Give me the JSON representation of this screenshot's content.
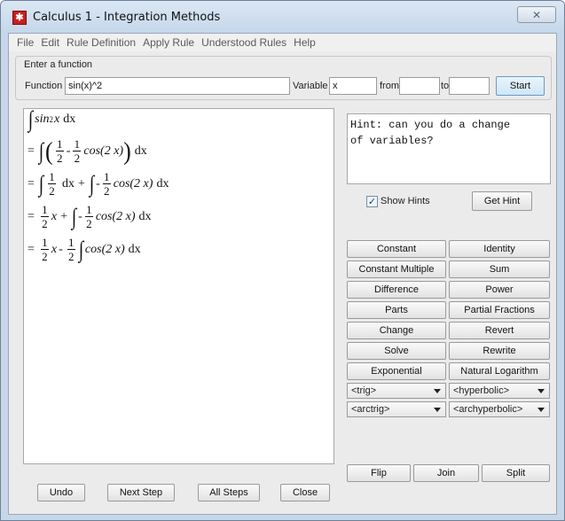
{
  "window": {
    "title": "Calculus 1 - Integration Methods",
    "close_glyph": "✕"
  },
  "menu": [
    "File",
    "Edit",
    "Rule Definition",
    "Apply Rule",
    "Understood Rules",
    "Help"
  ],
  "function_panel": {
    "legend": "Enter a function",
    "function_label": "Function",
    "function_value": "sin(x)^2",
    "variable_label": "Variable",
    "variable_value": "x",
    "from_label": "from",
    "from_value": "",
    "to_label": "to",
    "to_value": "",
    "start_label": "Start"
  },
  "work": {
    "integral_sign": "∫",
    "dx": "dx",
    "equals": "=",
    "plus": "+",
    "minus": "-",
    "one": "1",
    "two": "2",
    "x": "x",
    "sin": "sin",
    "sin_exp": "2",
    "cos_term": "cos(2 x)",
    "lparen": "(",
    "rparen": ")"
  },
  "hint": {
    "text": "Hint: can you do a change\nof variables?",
    "show_hints_label": "Show Hints",
    "show_hints_checked": true,
    "get_hint_label": "Get Hint"
  },
  "rules": [
    "Constant",
    "Identity",
    "Constant Multiple",
    "Sum",
    "Difference",
    "Power",
    "Parts",
    "Partial Fractions",
    "Change",
    "Revert",
    "Solve",
    "Rewrite",
    "Exponential",
    "Natural Logarithm"
  ],
  "combos": [
    "<trig>",
    "<hyperbolic>",
    "<arctrig>",
    "<archyperbolic>"
  ],
  "bottom_right": [
    "Flip",
    "Join",
    "Split"
  ],
  "bottom_left": [
    "Undo",
    "Next Step",
    "All Steps",
    "Close"
  ]
}
